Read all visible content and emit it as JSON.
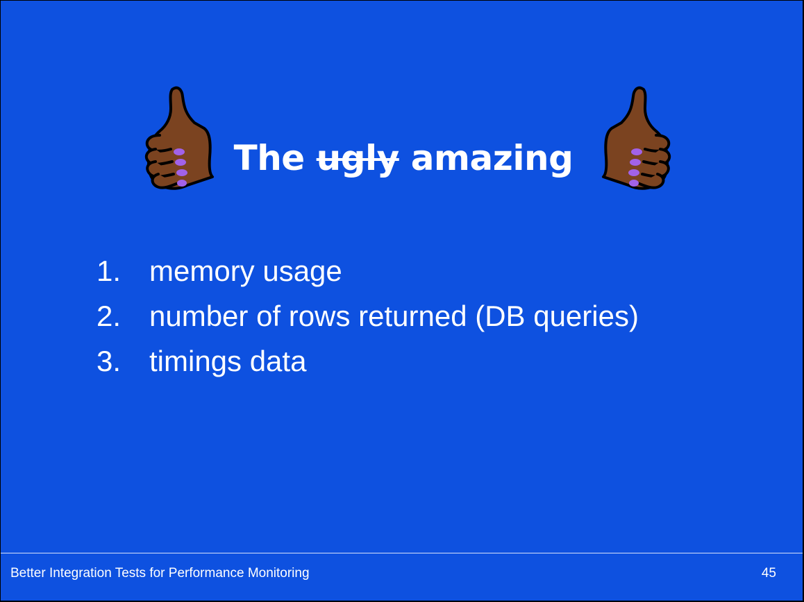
{
  "slide": {
    "title": {
      "before": "The",
      "struck": "ugly",
      "after": "amazing"
    },
    "items": [
      {
        "number": "1.",
        "text": "memory usage"
      },
      {
        "number": "2.",
        "text": "number of rows returned (DB queries)"
      },
      {
        "number": "3.",
        "text": "timings data"
      }
    ],
    "footer": {
      "title": "Better Integration Tests for Performance Monitoring",
      "page_number": "45"
    }
  },
  "icons": {
    "left": "thumbs-up-icon",
    "right": "thumbs-up-icon"
  },
  "colors": {
    "background": "#0e51e0",
    "text": "#ffffff",
    "skin": "#7b4320",
    "nail": "#a262e8"
  }
}
